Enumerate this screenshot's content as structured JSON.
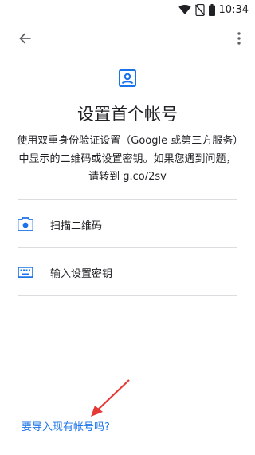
{
  "status_bar": {
    "time": "10:34",
    "icons": [
      "wifi-icon",
      "no-sim-icon",
      "battery-icon"
    ]
  },
  "app_bar": {
    "icons": [
      "back-arrow-icon",
      "more-vert-icon"
    ]
  },
  "setup": {
    "title": "设置首个帐号",
    "description": "使用双重身份验证设置（Google 或第三方服务）中显示的二维码或设置密钥。如果您遇到问题，请转到 g.co/2sv",
    "options": [
      {
        "label": "扫描二维码",
        "icon": "camera-icon"
      },
      {
        "label": "输入设置密钥",
        "icon": "keyboard-icon"
      }
    ],
    "import_link": "要导入现有帐号吗?"
  },
  "colors": {
    "accent": "#1a73e8",
    "annotation_arrow": "#e53935",
    "divider": "#dadce0",
    "text": "#202124"
  }
}
